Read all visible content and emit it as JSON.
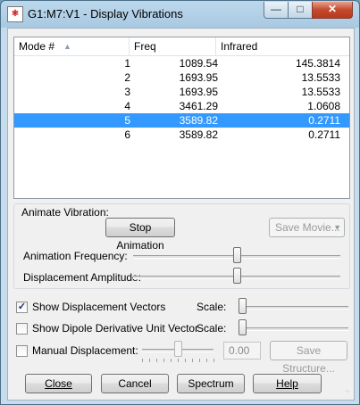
{
  "window": {
    "title": "G1:M7:V1 - Display Vibrations",
    "icon": "gaussview-app-icon",
    "controls": {
      "minimize": "—",
      "maximize": "□",
      "close": "✕"
    }
  },
  "table": {
    "columns": [
      "Mode #",
      "Freq",
      "Infrared"
    ],
    "sort_indicator": "▲",
    "rows": [
      {
        "mode": "1",
        "freq": "1089.54",
        "ir": "145.3814"
      },
      {
        "mode": "2",
        "freq": "1693.95",
        "ir": "13.5533"
      },
      {
        "mode": "3",
        "freq": "1693.95",
        "ir": "13.5533"
      },
      {
        "mode": "4",
        "freq": "3461.29",
        "ir": "1.0608"
      },
      {
        "mode": "5",
        "freq": "3589.82",
        "ir": "0.2711"
      },
      {
        "mode": "6",
        "freq": "3589.82",
        "ir": "0.2711"
      }
    ],
    "selected_row": 5
  },
  "animate": {
    "group_label": "Animate Vibration:",
    "stop_button": "Stop Animation",
    "save_movie_button": "Save Movie...",
    "frequency_label": "Animation Frequency:",
    "frequency_level": 0.5,
    "amplitude_label": "Displacement Amplitude:",
    "amplitude_level": 0.5
  },
  "options": {
    "show_vectors_label": "Show Displacement Vectors",
    "show_vectors_checked": true,
    "show_dipole_label": "Show Dipole Derivative Unit Vector",
    "show_dipole_checked": false,
    "manual_label": "Manual Displacement:",
    "manual_checked": false,
    "manual_value": "0.00",
    "manual_level": 0.5,
    "scale_label": "Scale:",
    "save_structure_button": "Save Structure...",
    "scale_vectors_level": 0.0,
    "scale_dipole_level": 0.0
  },
  "buttons": {
    "close": "Close",
    "cancel": "Cancel",
    "spectrum": "Spectrum",
    "help": "Help"
  },
  "colors": {
    "selection": "#3399ff",
    "titlebar": "#a9c9e2"
  }
}
